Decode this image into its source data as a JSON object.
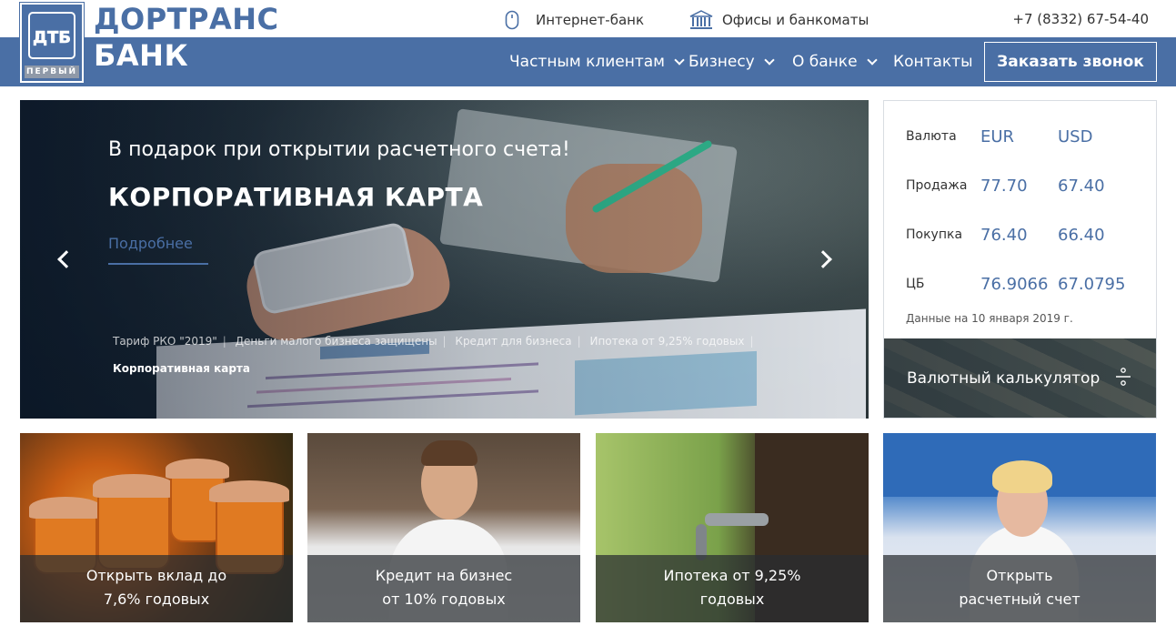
{
  "header": {
    "brand_line1": "ДОРТРАНС",
    "brand_line2": "БАНК",
    "logo_mark": "ДТБ",
    "logo_sub": "ПЕРВЫЙ",
    "internet_bank": "Интернет-банк",
    "offices": "Офисы и банкоматы",
    "phone": "+7 (8332) 67-54-40",
    "colors": {
      "brand": "#4a6fa5",
      "nav_bg": "#4a6fa5"
    }
  },
  "nav": {
    "items": [
      {
        "label": "Частным клиентам",
        "has_dropdown": true
      },
      {
        "label": "Бизнесу",
        "has_dropdown": true
      },
      {
        "label": "О банке",
        "has_dropdown": true
      },
      {
        "label": "Контакты",
        "has_dropdown": false
      }
    ],
    "call_button": "Заказать звонок"
  },
  "slider": {
    "subtitle": "В подарок при открытии расчетного счета!",
    "title": "КОРПОРАТИВНАЯ КАРТА",
    "more": "Подробнее",
    "tabs": [
      {
        "label": "Тариф РКО \"2019\"",
        "active": false
      },
      {
        "label": "Деньги малого бизнеса защищены",
        "active": false
      },
      {
        "label": "Кредит для бизнеса",
        "active": false
      },
      {
        "label": "Ипотека от 9,25% годовых",
        "active": false
      },
      {
        "label": "Корпоративная карта",
        "active": true
      }
    ],
    "separator": "|"
  },
  "rates": {
    "headers": [
      "Валюта",
      "EUR",
      "USD"
    ],
    "rows": [
      {
        "label": "Продажа",
        "eur": "77.70",
        "usd": "67.40"
      },
      {
        "label": "Покупка",
        "eur": "76.40",
        "usd": "66.40"
      },
      {
        "label": "ЦБ",
        "eur": "76.9066",
        "usd": "67.0795"
      }
    ],
    "note": "Данные на 10 января 2019 г.",
    "calculator": "Валютный калькулятор"
  },
  "cards": [
    {
      "line1": "Открыть вклад до",
      "line2": "7,6% годовых"
    },
    {
      "line1": "Кредит на бизнес",
      "line2": "от 10% годовых"
    },
    {
      "line1": "Ипотека от 9,25%",
      "line2": "годовых"
    },
    {
      "line1": "Открыть",
      "line2": "расчетный счет"
    }
  ]
}
